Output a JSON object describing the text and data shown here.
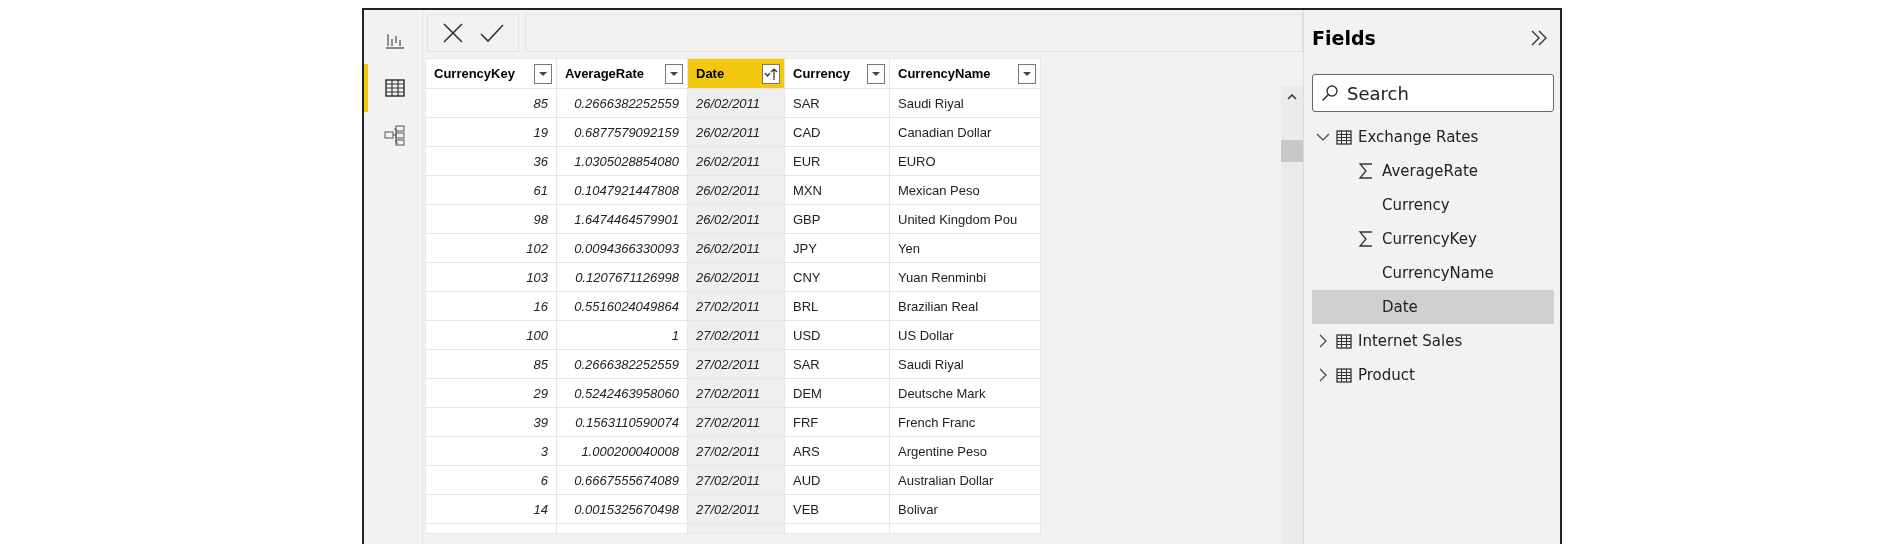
{
  "nav": [
    {
      "kind": "report",
      "selected": false
    },
    {
      "kind": "data",
      "selected": true
    },
    {
      "kind": "model",
      "selected": false
    }
  ],
  "table": {
    "columns": [
      {
        "label": "CurrencyKey",
        "selected": false,
        "sorted": false,
        "kind": "number"
      },
      {
        "label": "AverageRate",
        "selected": false,
        "sorted": false,
        "kind": "number"
      },
      {
        "label": "Date",
        "selected": true,
        "sorted": true,
        "kind": "date"
      },
      {
        "label": "Currency",
        "selected": false,
        "sorted": false,
        "kind": "text"
      },
      {
        "label": "CurrencyName",
        "selected": false,
        "sorted": false,
        "kind": "text"
      }
    ],
    "rows": [
      [
        "85",
        "0.2666382252559",
        "26/02/2011",
        "SAR",
        "Saudi Riyal"
      ],
      [
        "19",
        "0.6877579092159",
        "26/02/2011",
        "CAD",
        "Canadian Dollar"
      ],
      [
        "36",
        "1.0305028854080",
        "26/02/2011",
        "EUR",
        "EURO"
      ],
      [
        "61",
        "0.1047921447808",
        "26/02/2011",
        "MXN",
        "Mexican Peso"
      ],
      [
        "98",
        "1.6474464579901",
        "26/02/2011",
        "GBP",
        "United Kingdom Pou"
      ],
      [
        "102",
        "0.0094366330093",
        "26/02/2011",
        "JPY",
        "Yen"
      ],
      [
        "103",
        "0.1207671126998",
        "26/02/2011",
        "CNY",
        "Yuan Renminbi"
      ],
      [
        "16",
        "0.5516024049864",
        "27/02/2011",
        "BRL",
        "Brazilian Real"
      ],
      [
        "100",
        "1",
        "27/02/2011",
        "USD",
        "US Dollar"
      ],
      [
        "85",
        "0.2666382252559",
        "27/02/2011",
        "SAR",
        "Saudi Riyal"
      ],
      [
        "29",
        "0.5242463958060",
        "27/02/2011",
        "DEM",
        "Deutsche Mark"
      ],
      [
        "39",
        "0.1563110590074",
        "27/02/2011",
        "FRF",
        "French Franc"
      ],
      [
        "3",
        "1.000200040008",
        "27/02/2011",
        "ARS",
        "Argentine Peso"
      ],
      [
        "6",
        "0.6667555674089",
        "27/02/2011",
        "AUD",
        "Australian Dollar"
      ],
      [
        "14",
        "0.0015325670498",
        "27/02/2011",
        "VEB",
        "Bolivar"
      ]
    ]
  },
  "fields": {
    "title": "Fields",
    "search": {
      "placeholder": "Search"
    },
    "tables": [
      {
        "name": "Exchange Rates",
        "expanded": true,
        "children": [
          {
            "name": "AverageRate",
            "summarized": true,
            "selected": false
          },
          {
            "name": "Currency",
            "summarized": false,
            "selected": false
          },
          {
            "name": "CurrencyKey",
            "summarized": true,
            "selected": false
          },
          {
            "name": "CurrencyName",
            "summarized": false,
            "selected": false
          },
          {
            "name": "Date",
            "summarized": false,
            "selected": true
          }
        ]
      },
      {
        "name": "Internet Sales",
        "expanded": false
      },
      {
        "name": "Product",
        "expanded": false
      }
    ]
  }
}
